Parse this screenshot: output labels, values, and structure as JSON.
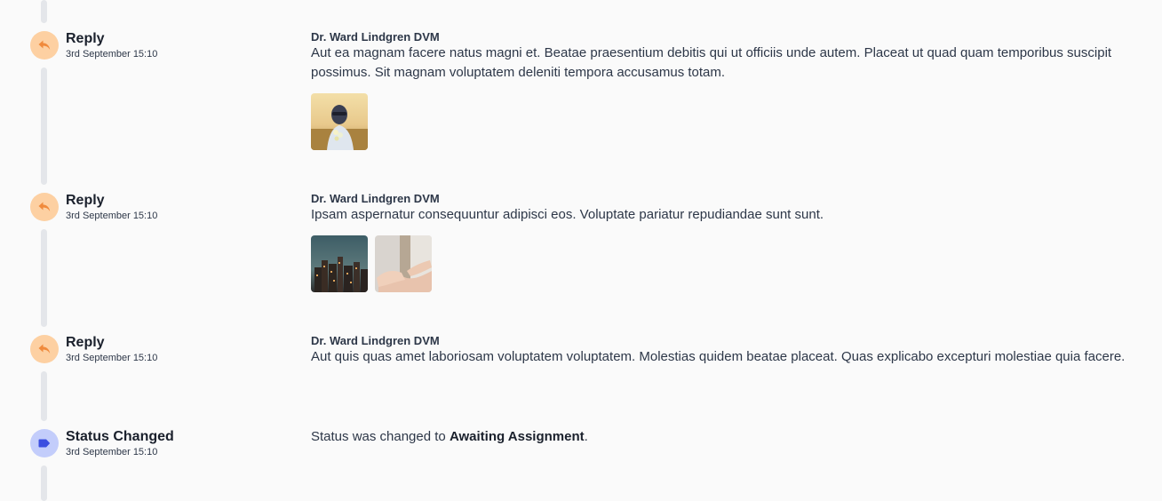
{
  "timeline": [
    {
      "kind": "reply",
      "type_label": "Reply",
      "timestamp": "3rd September 15:10",
      "author": "Dr. Ward Lindgren DVM",
      "message": "Aut ea magnam facere natus magni et. Beatae praesentium debitis qui ut officiis unde autem. Placeat ut quad quam temporibus suscipit possimus. Sit magnam voluptatem deleniti tempora accusamus totam.",
      "attachments": [
        "woman-with-flowers-photo"
      ]
    },
    {
      "kind": "reply",
      "type_label": "Reply",
      "timestamp": "3rd September 15:10",
      "author": "Dr. Ward Lindgren DVM",
      "message": "Ipsam aspernatur consequuntur adipisci eos. Voluptate pariatur repudiandae sunt sunt.",
      "attachments": [
        "city-skyline-photo",
        "hands-photo"
      ]
    },
    {
      "kind": "reply",
      "type_label": "Reply",
      "timestamp": "3rd September 15:10",
      "author": "Dr. Ward Lindgren DVM",
      "message": "Aut quis quas amet laboriosam voluptatem voluptatem. Molestias quidem beatae placeat. Quas explicabo excepturi molestiae quia facere.",
      "attachments": []
    },
    {
      "kind": "status",
      "type_label": "Status Changed",
      "timestamp": "3rd September 15:10",
      "message_prefix": "Status was changed to ",
      "status_value": "Awaiting Assignment",
      "message_suffix": "."
    }
  ],
  "colors": {
    "reply_dot": "#fdd0a2",
    "reply_icon": "#f08a3c",
    "status_dot": "#c3cdfb",
    "status_icon": "#3b4ee0",
    "timeline_line": "#e4e6ea"
  },
  "icons": {
    "reply": "reply-arrow-icon",
    "status": "tag-icon"
  }
}
